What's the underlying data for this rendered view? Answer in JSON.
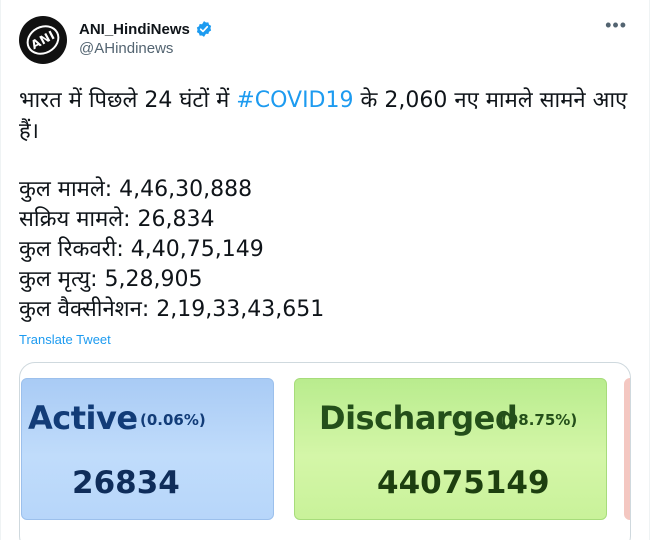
{
  "author": {
    "display_name": "ANI_HindiNews",
    "handle": "@AHindinews",
    "avatar_text": "ANI",
    "verified": true
  },
  "menu": {
    "more_icon": "more-horizontal-icon"
  },
  "tweet": {
    "text_before": "भारत में पिछले 24 घंटों में ",
    "hashtag": "#COVID19",
    "text_after": " के 2,060 नए मामले सामने आए हैं।",
    "stats": [
      "कुल मामले: 4,46,30,888",
      "सक्रिय मामले: 26,834",
      "कुल रिकवरी: 4,40,75,149",
      "कुल मृत्यु: 5,28,905",
      "कुल वैक्सीनेशन: 2,19,33,43,651"
    ],
    "translate_label": "Translate Tweet"
  },
  "media": {
    "active": {
      "title": "Active",
      "percent": "(0.06%)",
      "value": "26834"
    },
    "discharged": {
      "title": "Discharged",
      "percent": "(98.75%)",
      "value": "44075149"
    }
  },
  "colors": {
    "link": "#1d9bf0",
    "verified": "#1d9bf0",
    "active_tile": "#b7d6fa",
    "discharged_tile": "#c9f29a"
  }
}
